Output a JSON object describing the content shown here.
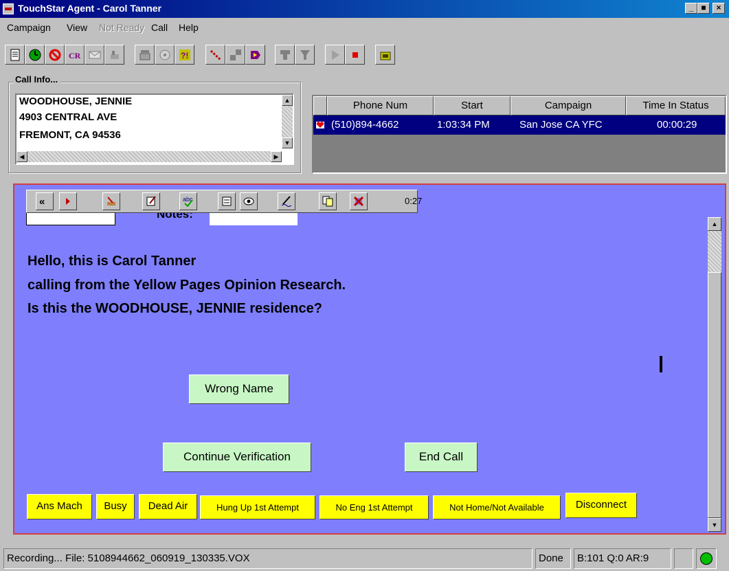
{
  "window": {
    "title": "TouchStar Agent - Carol Tanner"
  },
  "menu": {
    "items": [
      {
        "label": "Campaign",
        "enabled": true
      },
      {
        "label": "View",
        "enabled": true
      },
      {
        "label": "Not Ready",
        "enabled": false
      },
      {
        "label": "Call",
        "enabled": true
      },
      {
        "label": "Help",
        "enabled": true
      }
    ]
  },
  "toolbar": {
    "icons": [
      "script-icon",
      "clock-icon",
      "no-entry-icon",
      "crc-icon",
      "envelope-icon",
      "phone-hand-icon",
      "phone-icon",
      "dial-icon",
      "transfer-icon",
      "link-icon",
      "conference-icon",
      "forward-icon",
      "split-icon",
      "merge-icon",
      "play-icon",
      "stop-icon",
      "headset-icon"
    ]
  },
  "call_info": {
    "label": "Call Info...",
    "lines": [
      "WOODHOUSE, JENNIE",
      "4903  CENTRAL AVE",
      "FREMONT,  CA 94536"
    ]
  },
  "call_grid": {
    "columns": [
      "Phone Num",
      "Start",
      "Campaign",
      "Time In Status"
    ],
    "rows": [
      {
        "phone": "(510)894-4662",
        "start": "1:03:34 PM",
        "campaign": "San Jose CA YFC",
        "time": "00:00:29"
      }
    ]
  },
  "script_toolbar": {
    "icons": [
      "rewind-icon",
      "back-icon",
      "hand-icon",
      "edit-icon",
      "spell-check-icon",
      "form-icon",
      "eye-icon",
      "signature-icon",
      "copy-icon",
      "cancel-icon"
    ],
    "timer": "0:27"
  },
  "script": {
    "notes_label": "Notes:",
    "lines": [
      "Hello, this is Carol Tanner",
      "calling from the Yellow Pages Opinion Research.",
      "Is this the WOODHOUSE, JENNIE residence?"
    ],
    "buttons": {
      "wrong_name": "Wrong Name",
      "continue_verification": "Continue Verification",
      "end_call": "End Call"
    },
    "dispositions": [
      "Ans Mach",
      "Busy",
      "Dead Air",
      "Hung Up 1st Attempt",
      "No Eng 1st Attempt",
      "Not Home/Not Available",
      "Disconnect"
    ]
  },
  "status_bar": {
    "recording": "Recording... File: 5108944662_060919_130335.VOX",
    "state": "Done",
    "counters": "B:101 Q:0 AR:9",
    "indicator_color": "#00c000"
  }
}
